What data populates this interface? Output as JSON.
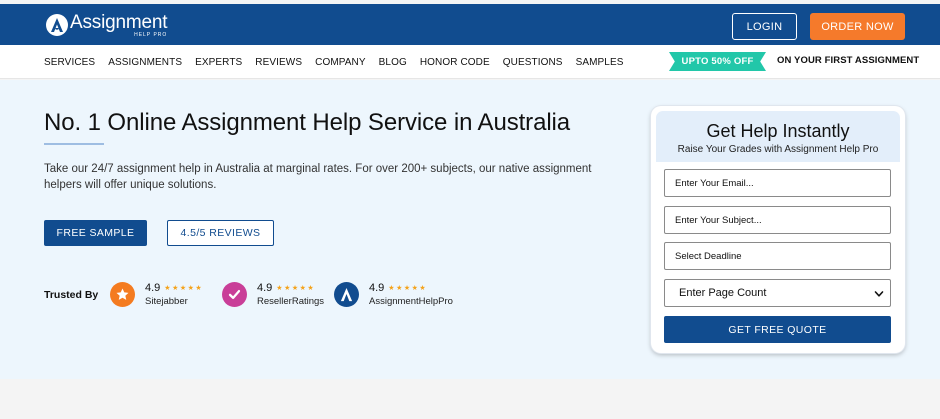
{
  "header": {
    "logo_text": "Assignment",
    "logo_subtext": "HELP PRO",
    "login_label": "LOGIN",
    "order_label": "ORDER NOW"
  },
  "nav": {
    "items": [
      "SERVICES",
      "ASSIGNMENTS",
      "EXPERTS",
      "REVIEWS",
      "COMPANY",
      "BLOG",
      "HONOR CODE",
      "QUESTIONS",
      "SAMPLES"
    ],
    "promo_tag": "UPTO 50% OFF",
    "promo_text": "ON YOUR FIRST ASSIGNMENT"
  },
  "hero": {
    "title": "No. 1 Online Assignment Help Service in Australia",
    "description": "Take our 24/7 assignment help in Australia at marginal rates. For over 200+ subjects, our native assignment helpers will offer unique solutions.",
    "free_sample_label": "FREE SAMPLE",
    "reviews_label": "4.5/5 REVIEWS"
  },
  "trusted": {
    "label": "Trusted By",
    "badges": [
      {
        "score": "4.9",
        "stars": "★★★★★",
        "name": "Sitejabber",
        "icon": "sitejabber-star-icon",
        "color": "#f47b20"
      },
      {
        "score": "4.9",
        "stars": "★★★★★",
        "name": "ResellerRatings",
        "icon": "resellerratings-check-icon",
        "color": "#c93e98"
      },
      {
        "score": "4.9",
        "stars": "★★★★★",
        "name": "AssignmentHelpPro",
        "icon": "assignmenthelppro-logo-icon",
        "color": "#114c8f"
      }
    ]
  },
  "form": {
    "title": "Get Help Instantly",
    "subtitle": "Raise Your Grades with Assignment Help Pro",
    "email_placeholder": "Enter Your Email...",
    "subject_placeholder": "Enter Your Subject...",
    "deadline_placeholder": "Select Deadline",
    "page_count_selected": "Enter Page Count",
    "submit_label": "GET FREE QUOTE"
  },
  "colors": {
    "brand_blue": "#114c8f",
    "accent_orange": "#f57a2b",
    "promo_teal": "#22c7a9",
    "hero_bg": "#edf6fd",
    "star_gold": "#f4a31c"
  }
}
